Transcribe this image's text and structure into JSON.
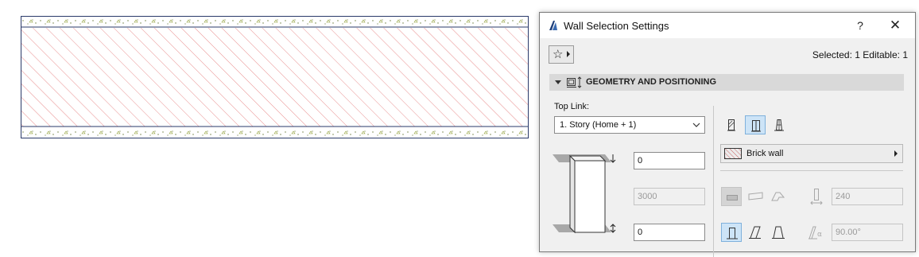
{
  "dialog": {
    "title": "Wall Selection Settings",
    "help_label": "?",
    "close_label": "✕",
    "selection_status": "Selected: 1 Editable: 1",
    "section_title": "GEOMETRY AND POSITIONING"
  },
  "top_link": {
    "label": "Top Link:",
    "value": "1. Story (Home + 1)"
  },
  "offsets": {
    "top_offset": "0",
    "height": "3000",
    "bottom_offset": "0"
  },
  "structure": {
    "composite_name": "Brick wall",
    "thickness": "240",
    "slant_angle": "90.00°"
  },
  "icons": {
    "app": "archicad-icon",
    "favorites": "star-icon",
    "section": "geometry-icon"
  },
  "colors": {
    "hatch": "#e06060",
    "selection": "#cde4f7",
    "finish_dots": "#5a7a2a"
  }
}
